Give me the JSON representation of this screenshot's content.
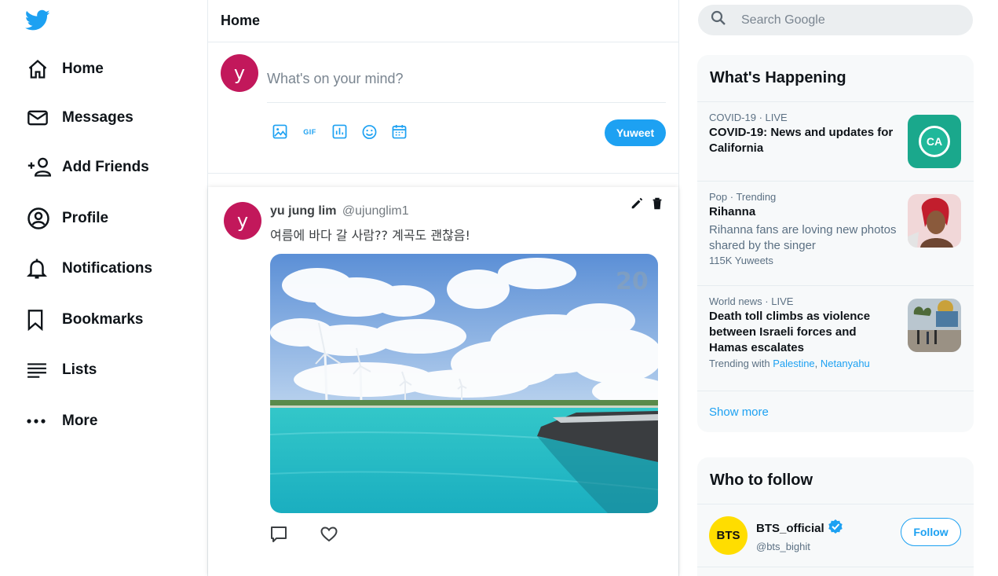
{
  "brand": {
    "accent": "#1da1f2",
    "avatar_color": "#c2185b"
  },
  "sidebar": {
    "items": [
      {
        "label": "Home",
        "icon": "home-icon"
      },
      {
        "label": "Messages",
        "icon": "mail-icon"
      },
      {
        "label": "Add Friends",
        "icon": "add-friend-icon"
      },
      {
        "label": "Profile",
        "icon": "profile-icon"
      },
      {
        "label": "Notifications",
        "icon": "bell-icon"
      },
      {
        "label": "Bookmarks",
        "icon": "bookmark-icon"
      },
      {
        "label": "Lists",
        "icon": "list-icon"
      },
      {
        "label": "More",
        "icon": "more-icon"
      }
    ]
  },
  "header": {
    "title": "Home"
  },
  "composer": {
    "avatar_letter": "y",
    "placeholder": "What's on your mind?",
    "tools": [
      "image-icon",
      "gif-icon",
      "poll-icon",
      "emoji-icon",
      "schedule-icon"
    ],
    "gif_label": "GIF",
    "submit_label": "Yuweet"
  },
  "post": {
    "avatar_letter": "y",
    "name": "yu jung lim",
    "handle": "@ujunglim1",
    "text": "여름에 바다 갈 사람?? 계곡도 괜찮음!"
  },
  "search": {
    "placeholder": "Search Google"
  },
  "happening": {
    "title": "What's Happening",
    "trends": [
      {
        "meta": "COVID-19 · LIVE",
        "title": "COVID-19: News and updates for California",
        "thumb_label": "CA"
      },
      {
        "meta": "Pop · Trending",
        "title": "Rihanna",
        "desc": "Rihanna fans are loving new photos shared by the singer",
        "count": "115K Yuweets"
      },
      {
        "meta": "World news · LIVE",
        "title": "Death toll climbs as violence between Israeli forces and Hamas escalates",
        "with_prefix": "Trending with",
        "with_links": [
          "Palestine",
          "Netanyahu"
        ]
      }
    ],
    "show_more": "Show more"
  },
  "who_to_follow": {
    "title": "Who to follow",
    "accounts": [
      {
        "name": "BTS_official",
        "handle": "@bts_bighit",
        "avatar_text": "BTS",
        "button": "Follow"
      }
    ]
  }
}
